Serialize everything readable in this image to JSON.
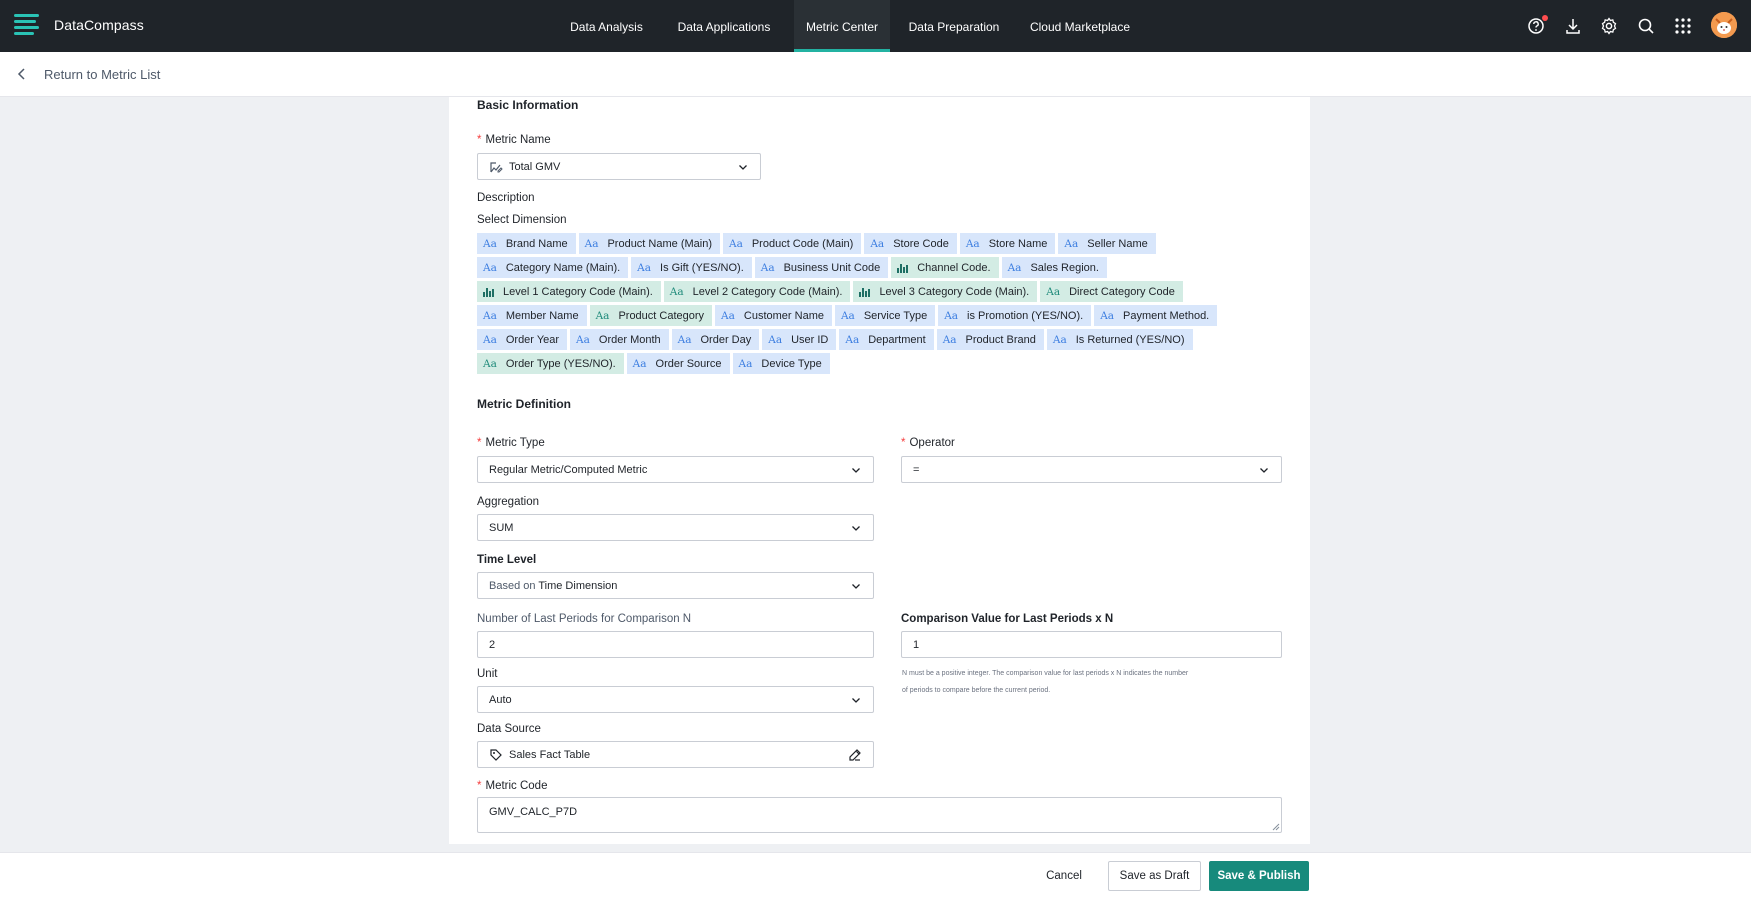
{
  "app": {
    "title": "DataCompass",
    "brand_color": "#2ac3b5",
    "accent": "#178a7c"
  },
  "nav": {
    "tabs": [
      {
        "label": "Data Analysis",
        "active": false
      },
      {
        "label": "Data Applications",
        "active": false
      },
      {
        "label": "Metric Center",
        "active": true
      },
      {
        "label": "Data Preparation",
        "active": false
      },
      {
        "label": "Cloud Marketplace",
        "active": false
      }
    ],
    "icons": [
      "help-icon",
      "download-icon",
      "settings-icon",
      "search-icon",
      "apps-grid-icon",
      "user-avatar"
    ]
  },
  "subheader": {
    "back_label": "Return to Metric List"
  },
  "basic": {
    "title": "Basic Information",
    "metric_name_label": "Metric Name",
    "metric_name_value": "Total GMV",
    "description_label": "Description",
    "dimension_label": "Select Dimension",
    "dimensions": [
      [
        {
          "label": "Brand Name",
          "kind": "text"
        },
        {
          "label": "Product Name (Main)",
          "kind": "text"
        },
        {
          "label": "Product Code (Main)",
          "kind": "text"
        },
        {
          "label": "Store Code",
          "kind": "text"
        },
        {
          "label": "Store Name",
          "kind": "text"
        },
        {
          "label": "Seller Name",
          "kind": "text"
        }
      ],
      [
        {
          "label": "Category Name (Main).",
          "kind": "text"
        },
        {
          "label": "Is Gift (YES/NO).",
          "kind": "text"
        },
        {
          "label": "Business Unit Code",
          "kind": "text"
        },
        {
          "label": "Channel Code.",
          "kind": "bar"
        },
        {
          "label": "Sales Region.",
          "kind": "text"
        }
      ],
      [
        {
          "label": "Level 1 Category Code (Main).",
          "kind": "bar"
        },
        {
          "label": "Level 2 Category Code (Main).",
          "kind": "text-teal"
        },
        {
          "label": "Level 3 Category Code (Main).",
          "kind": "bar"
        },
        {
          "label": "Direct Category Code",
          "kind": "text-teal"
        }
      ],
      [
        {
          "label": "Member Name",
          "kind": "text"
        },
        {
          "label": "Product Category",
          "kind": "text-teal"
        },
        {
          "label": "Customer Name",
          "kind": "text"
        },
        {
          "label": "Service Type",
          "kind": "text"
        },
        {
          "label": "is Promotion (YES/NO).",
          "kind": "text"
        },
        {
          "label": "Payment Method.",
          "kind": "text"
        }
      ],
      [
        {
          "label": "Order Year",
          "kind": "text"
        },
        {
          "label": "Order Month",
          "kind": "text"
        },
        {
          "label": "Order Day",
          "kind": "text"
        },
        {
          "label": "User ID",
          "kind": "text"
        },
        {
          "label": "Department",
          "kind": "text"
        },
        {
          "label": "Product Brand",
          "kind": "text"
        },
        {
          "label": "Is Returned (YES/NO)",
          "kind": "text"
        }
      ],
      [
        {
          "label": "Order Type (YES/NO).",
          "kind": "text-teal"
        },
        {
          "label": "Order Source",
          "kind": "text"
        },
        {
          "label": "Device Type",
          "kind": "text"
        }
      ]
    ],
    "tag_glyph": "Aa"
  },
  "definition": {
    "title": "Metric Definition",
    "metric_type_label": "Metric Type",
    "metric_type_value": "Regular Metric/Computed Metric",
    "operator_label": "Operator",
    "operator_value": "=",
    "aggregation_label": "Aggregation",
    "aggregation_value": "SUM",
    "time_level_label": "Time Level",
    "time_level_prefix": "Based on ",
    "time_level_value": "Time Dimension",
    "periods_label": "Number of Last Periods for Comparison N",
    "periods_value": "2",
    "comparison_label": "Comparison Value for Last Periods x N",
    "comparison_value": "1",
    "hint_line1": "N must be a positive integer. The comparison value for last periods x N indicates the number",
    "hint_line2": "of periods to compare before the current period.",
    "unit_label": "Unit",
    "unit_value": "Auto",
    "source_label": "Data Source",
    "source_value": "Sales Fact Table",
    "code_label": "Metric Code",
    "code_value": "GMV_CALC_P7D"
  },
  "footer": {
    "cancel": "Cancel",
    "draft": "Save as Draft",
    "publish": "Save & Publish"
  }
}
